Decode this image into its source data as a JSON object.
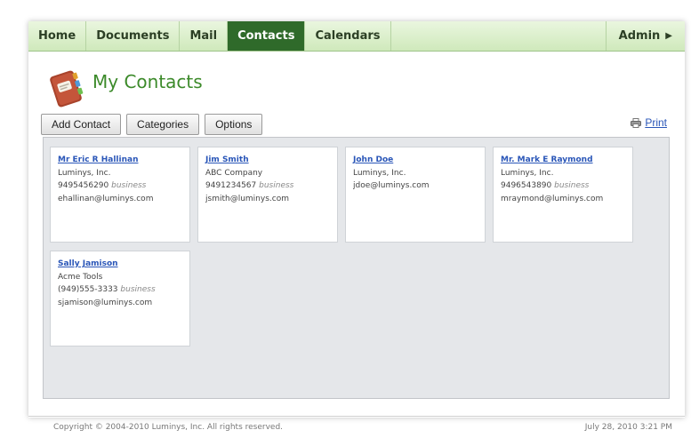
{
  "nav": {
    "tabs": [
      {
        "label": "Home",
        "active": false
      },
      {
        "label": "Documents",
        "active": false
      },
      {
        "label": "Mail",
        "active": false
      },
      {
        "label": "Contacts",
        "active": true
      },
      {
        "label": "Calendars",
        "active": false
      }
    ],
    "admin_label": "Admin",
    "admin_arrow": "▶"
  },
  "header": {
    "title": "My Contacts",
    "icon": "address-book-icon"
  },
  "toolbar": {
    "add_contact": "Add Contact",
    "categories": "Categories",
    "options": "Options",
    "print": "Print",
    "print_icon": "printer-icon"
  },
  "contacts": [
    {
      "name": "Mr Eric R Hallinan",
      "company": "Luminys, Inc.",
      "phone": "9495456290",
      "phone_type": "business",
      "email": "ehallinan@luminys.com"
    },
    {
      "name": "Jim Smith",
      "company": "ABC Company",
      "phone": "9491234567",
      "phone_type": "business",
      "email": "jsmith@luminys.com"
    },
    {
      "name": "John Doe",
      "company": "Luminys, Inc.",
      "phone": "",
      "phone_type": "",
      "email": "jdoe@luminys.com"
    },
    {
      "name": "Mr. Mark E Raymond",
      "company": "Luminys, Inc.",
      "phone": "9496543890",
      "phone_type": "business",
      "email": "mraymond@luminys.com"
    },
    {
      "name": "Sally Jamison",
      "company": "Acme Tools",
      "phone": "(949)555-3333",
      "phone_type": "business",
      "email": "sjamison@luminys.com"
    }
  ],
  "footer": {
    "copyright": "Copyright © 2004-2010 Luminys, Inc. All rights reserved.",
    "timestamp": "July 28, 2010 3:21 PM"
  },
  "colors": {
    "nav_active": "#2f6a2a",
    "title": "#3c8a2a",
    "link": "#2a56b8"
  }
}
